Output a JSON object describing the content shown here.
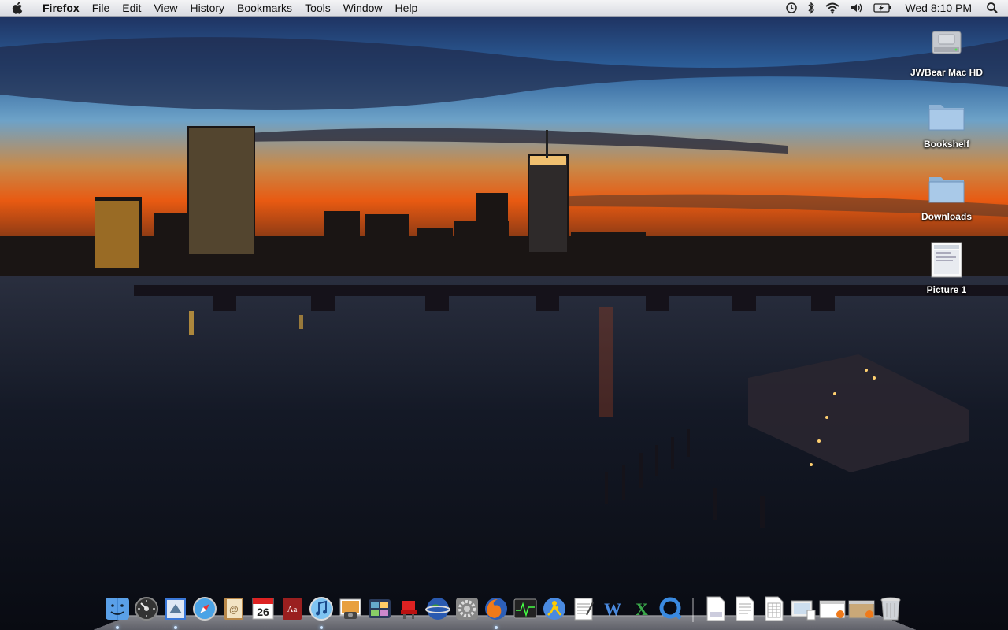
{
  "menubar": {
    "app_name": "Firefox",
    "menus": [
      "File",
      "Edit",
      "View",
      "History",
      "Bookmarks",
      "Tools",
      "Window",
      "Help"
    ],
    "status_icons": [
      "time-machine-icon",
      "bluetooth-icon",
      "wifi-icon",
      "volume-icon",
      "battery-icon"
    ],
    "clock": "Wed 8:10 PM",
    "spotlight_icon": "spotlight-search-icon"
  },
  "desktop": {
    "icons": [
      {
        "label": "JWBear Mac HD",
        "icon": "hard-drive-icon"
      },
      {
        "label": "Bookshelf",
        "icon": "folder-icon"
      },
      {
        "label": "Downloads",
        "icon": "folder-icon"
      },
      {
        "label": "Picture 1",
        "icon": "screenshot-file-icon"
      }
    ]
  },
  "dock": {
    "apps": [
      {
        "name": "Finder",
        "icon": "finder-icon",
        "running": true
      },
      {
        "name": "Dashboard",
        "icon": "dashboard-icon",
        "running": false
      },
      {
        "name": "Mail",
        "icon": "mail-icon",
        "running": true
      },
      {
        "name": "Safari",
        "icon": "safari-icon",
        "running": false
      },
      {
        "name": "Address Book",
        "icon": "address-book-icon",
        "running": false
      },
      {
        "name": "iCal",
        "icon": "ical-icon",
        "running": false,
        "date": "26"
      },
      {
        "name": "Dictionary",
        "icon": "dictionary-icon",
        "running": false
      },
      {
        "name": "iTunes",
        "icon": "itunes-icon",
        "running": true
      },
      {
        "name": "iPhoto",
        "icon": "iphoto-icon",
        "running": false
      },
      {
        "name": "Spaces",
        "icon": "spaces-icon",
        "running": false
      },
      {
        "name": "Front Row",
        "icon": "front-row-icon",
        "running": false
      },
      {
        "name": "Google Earth",
        "icon": "google-earth-icon",
        "running": false
      },
      {
        "name": "System Preferences",
        "icon": "system-preferences-icon",
        "running": false
      },
      {
        "name": "Firefox",
        "icon": "firefox-icon",
        "running": true
      },
      {
        "name": "Activity Monitor",
        "icon": "activity-monitor-icon",
        "running": false
      },
      {
        "name": "AIM",
        "icon": "aim-icon",
        "running": false
      },
      {
        "name": "TextEdit",
        "icon": "textedit-icon",
        "running": false
      },
      {
        "name": "Word",
        "icon": "word-icon",
        "running": false
      },
      {
        "name": "Excel",
        "icon": "excel-icon",
        "running": false
      },
      {
        "name": "QuickTime",
        "icon": "quicktime-icon",
        "running": false
      }
    ],
    "docs": [
      {
        "name": "Document",
        "icon": "docx-doc-icon"
      },
      {
        "name": "Document",
        "icon": "text-doc-icon"
      },
      {
        "name": "Document",
        "icon": "spreadsheet-doc-icon"
      },
      {
        "name": "Downloads Stack",
        "icon": "downloads-stack-icon"
      },
      {
        "name": "Window",
        "icon": "minimized-window-icon"
      },
      {
        "name": "Window",
        "icon": "minimized-window-icon"
      },
      {
        "name": "Trash",
        "icon": "trash-icon"
      }
    ]
  }
}
